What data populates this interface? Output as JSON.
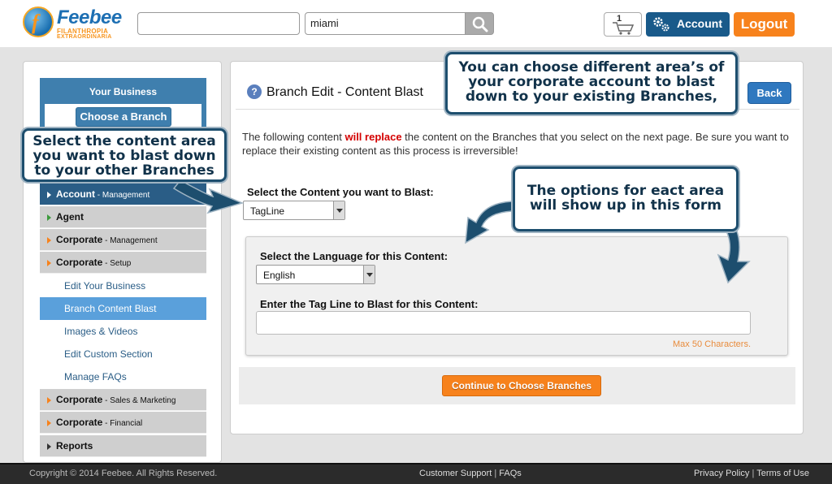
{
  "header": {
    "logo_name": "Feebee",
    "logo_tag1": "FILANTHROPIA",
    "logo_tag2": "EXTRAORDINARIA",
    "search_location_value": "miami",
    "cart_count": "1",
    "account_label": "Account",
    "logout_label": "Logout"
  },
  "sidebar": {
    "title": "Your Business",
    "choose_branch": "Choose a Branch",
    "items": [
      {
        "label": "Account",
        "sub": " - Management"
      },
      {
        "label": "Agent",
        "sub": ""
      },
      {
        "label": "Corporate",
        "sub": " - Management"
      },
      {
        "label": "Corporate",
        "sub": " - Setup"
      },
      {
        "label": "Corporate",
        "sub": " - Sales & Marketing"
      },
      {
        "label": "Corporate",
        "sub": " - Financial"
      },
      {
        "label": "Reports",
        "sub": ""
      }
    ],
    "subitems": [
      "Edit Your Business",
      "Branch Content Blast",
      "Images & Videos",
      "Edit Custom Section",
      "Manage FAQs"
    ]
  },
  "main": {
    "help": "?",
    "title": "Branch Edit - Content Blast",
    "back_label": "Back",
    "intro_pre": "The following content ",
    "intro_red": "will replace",
    "intro_post": " the content on the Branches that you select on the next page. Be sure you want to replace their existing content as this process is irreversible!",
    "blast_label": "Select the Content you want to Blast:",
    "blast_value": "TagLine",
    "language_label": "Select the Language for this Content:",
    "language_value": "English",
    "tagline_label": "Enter the Tag Line to Blast for this Content:",
    "max_chars": "Max 50 Characters.",
    "continue_label": "Continue to Choose Branches"
  },
  "callouts": {
    "a": [
      "Select the content area",
      "you want to blast down",
      "to your other Branches"
    ],
    "b": [
      "You can choose different area’s of",
      "your corporate account to blast",
      "down to your existing Branches,"
    ],
    "c": [
      "The options for eact area",
      "will show up in this form"
    ]
  },
  "footer": {
    "copyright": "Copyright © 2014 Feebee. All Rights Reserved.",
    "support": "Customer Support",
    "faqs": "FAQs",
    "privacy": "Privacy Policy",
    "terms": "Terms of Use",
    "sep": " | "
  },
  "colors": {
    "brand_blue": "#195a8a",
    "accent_orange": "#f7821c",
    "sidebar_active": "#2a5d86",
    "sub_active": "#5aa0db"
  }
}
